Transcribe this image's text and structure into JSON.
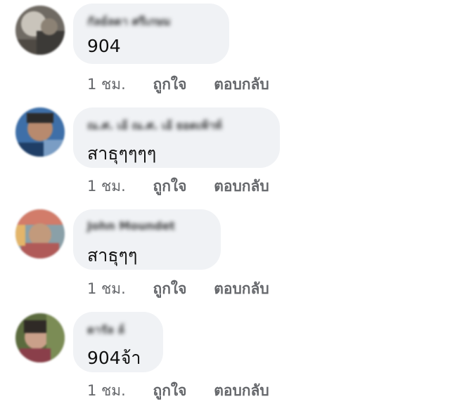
{
  "comments": [
    {
      "name": "กัลย์ลดา ศรีเกษม",
      "text": "904",
      "time": "1 ชม.",
      "like": "ถูกใจ",
      "reply": "ตอบกลับ"
    },
    {
      "name": "ณ.ศ. เอ้ ณ.ศ. เอ้ ยอดเพ้าท์",
      "text": "สาธุๆๆๆๆ",
      "time": "1 ชม.",
      "like": "ถูกใจ",
      "reply": "ตอบกลับ"
    },
    {
      "name": "John Moundet",
      "text": "สาธุๆๆ",
      "time": "1 ชม.",
      "like": "ถูกใจ",
      "reply": "ตอบกลับ"
    },
    {
      "name": "ดารัล ล์",
      "text": "904จ้า",
      "time": "1 ชม.",
      "like": "ถูกใจ",
      "reply": "ตอบกลับ"
    }
  ]
}
